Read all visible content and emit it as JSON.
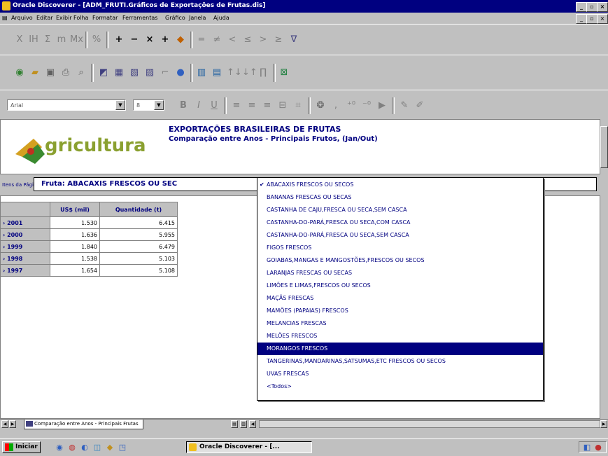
{
  "window": {
    "title": "Oracle Discoverer - [ADM_FRUTI.Gráficos de Exportações de Frutas.dis]"
  },
  "menu": [
    "Arquivo",
    "Editar",
    "Exibir",
    "Folha",
    "Formatar",
    "Ferramentas",
    "Gráfico",
    "Janela",
    "Ajuda"
  ],
  "toolbar1": [
    "X",
    "IH",
    "Σ",
    "m",
    "Mx",
    "%",
    "+",
    "−",
    "×",
    "+",
    "◆",
    "=",
    "≠",
    "<",
    "≤",
    ">",
    "≥",
    "∇"
  ],
  "format_toolbar": {
    "font": "Arial",
    "size": "8"
  },
  "report": {
    "logo_text": "gricultura",
    "title": "EXPORTAÇÕES BRASILEIRAS DE FRUTAS",
    "subtitle": "Comparação entre Anos - Principais Frutos, (Jan/Out)"
  },
  "page_items": {
    "label": "Itens da Página:",
    "value": "Fruta: ABACAXIS FRESCOS OU SEC"
  },
  "grid": {
    "columns": [
      "US$ (mil)",
      "Quantidade (t)"
    ],
    "rows": [
      {
        "year": "2001",
        "usd": "1.530",
        "qty": "6.415"
      },
      {
        "year": "2000",
        "usd": "1.636",
        "qty": "5.955"
      },
      {
        "year": "1999",
        "usd": "1.840",
        "qty": "6.479"
      },
      {
        "year": "1998",
        "usd": "1.538",
        "qty": "5.103"
      },
      {
        "year": "1997",
        "usd": "1.654",
        "qty": "5.108"
      }
    ]
  },
  "dropdown": {
    "options": [
      "ABACAXIS FRESCOS OU SECOS",
      "BANANAS FRESCAS OU SECAS",
      "CASTANHA DE CAJU,FRESCA OU SECA,SEM CASCA",
      "CASTANHA-DO-PARÁ,FRESCA OU SECA,COM CASCA",
      "CASTANHA-DO-PARÁ,FRESCA OU SECA,SEM CASCA",
      "FIGOS FRESCOS",
      "GOIABAS,MANGAS E MANGOSTÕES,FRESCOS OU SECOS",
      "LARANJAS FRESCAS OU SECAS",
      "LIMÕES E LIMAS,FRESCOS OU SECOS",
      "MAÇÃS FRESCAS",
      "MAMÕES (PAPAIAS) FRESCOS",
      "MELANCIAS FRESCAS",
      "MELÕES FRESCOS",
      "MORANGOS FRESCOS",
      "TANGERINAS,MANDARINAS,SATSUMAS,ETC FRESCOS OU SECOS",
      "UVAS FRESCAS",
      "<Todos>"
    ],
    "checked_index": 0,
    "selected_index": 13
  },
  "sheet": {
    "tab_label": "Comparação entre Anos - Principais Frutas"
  },
  "taskbar": {
    "start_label": "Iniciar",
    "task_label": "Oracle Discoverer - [..."
  },
  "colors": {
    "title_bar": "#000080",
    "highlight": "#000080",
    "window_face": "#c0c0c0"
  }
}
